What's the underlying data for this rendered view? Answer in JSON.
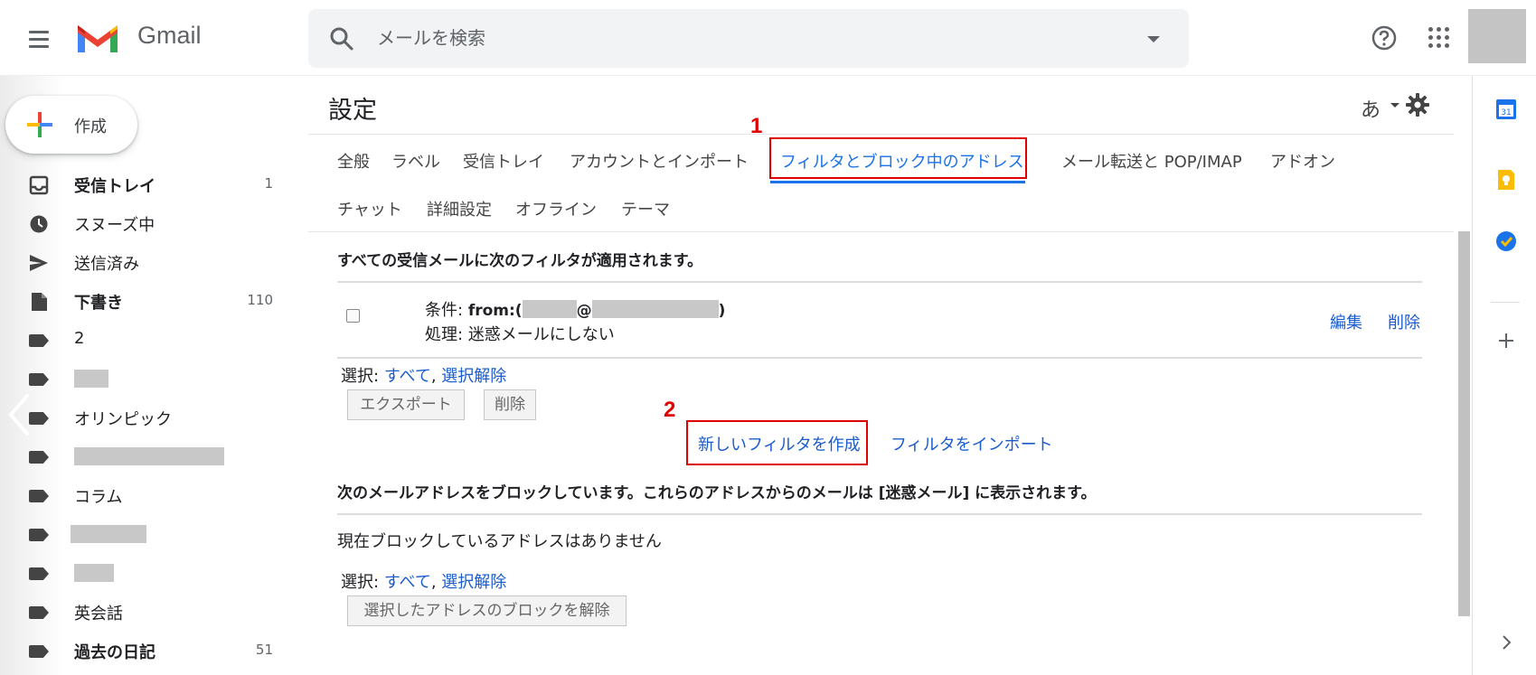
{
  "header": {
    "app_name": "Gmail",
    "search_placeholder": "メールを検索"
  },
  "sidebar": {
    "compose_label": "作成",
    "items": [
      {
        "label": "受信トレイ",
        "count": "1",
        "bold": true,
        "icon": "inbox-icon"
      },
      {
        "label": "スヌーズ中",
        "count": "",
        "bold": false,
        "icon": "clock-icon"
      },
      {
        "label": "送信済み",
        "count": "",
        "bold": false,
        "icon": "send-icon"
      },
      {
        "label": "下書き",
        "count": "110",
        "bold": true,
        "icon": "draft-icon"
      },
      {
        "label": "2",
        "count": "",
        "bold": false,
        "icon": "label-icon"
      },
      {
        "label": "",
        "count": "",
        "bold": false,
        "icon": "label-icon"
      },
      {
        "label": "オリンピック",
        "count": "",
        "bold": false,
        "icon": "label-icon"
      },
      {
        "label": "",
        "count": "",
        "bold": false,
        "icon": "label-icon"
      },
      {
        "label": "コラム",
        "count": "",
        "bold": false,
        "icon": "label-icon"
      },
      {
        "label": "",
        "count": "",
        "bold": false,
        "icon": "label-icon"
      },
      {
        "label": "",
        "count": "",
        "bold": false,
        "icon": "label-icon"
      },
      {
        "label": "英会話",
        "count": "",
        "bold": false,
        "icon": "label-icon"
      },
      {
        "label": "過去の日記",
        "count": "51",
        "bold": true,
        "icon": "label-icon"
      }
    ]
  },
  "settings": {
    "title": "設定",
    "lang_icon": "あ",
    "tabs": [
      "全般",
      "ラベル",
      "受信トレイ",
      "アカウントとインポート",
      "フィルタとブロック中のアドレス",
      "メール転送と POP/IMAP",
      "アドオン",
      "チャット",
      "詳細設定",
      "オフライン",
      "テーマ"
    ],
    "active_tab": "フィルタとブロック中のアドレス",
    "annotations": {
      "step1": "1",
      "step2": "2"
    },
    "filters": {
      "heading": "すべての受信メールに次のフィルタが適用されます。",
      "item": {
        "condition_label": "条件:",
        "condition_from": "from:(",
        "condition_at": "@",
        "condition_close": ")",
        "action_label": "処理:",
        "action_value": "迷惑メールにしない",
        "edit": "編集",
        "delete": "削除"
      },
      "select_label": "選択:",
      "select_all": "すべて",
      "select_none": "選択解除",
      "export_button": "エクスポート",
      "delete_button": "削除",
      "create_link": "新しいフィルタを作成",
      "import_link": "フィルタをインポート"
    },
    "blocked": {
      "heading": "次のメールアドレスをブロックしています。これらのアドレスからのメールは [迷惑メール] に表示されます。",
      "empty_text": "現在ブロックしているアドレスはありません",
      "select_label": "選択:",
      "select_all": "すべて",
      "select_none": "選択解除",
      "unblock_button": "選択したアドレスのブロックを解除"
    }
  },
  "side_panel": {
    "calendar_day": "31"
  },
  "colors": {
    "accent": "#1a73e8",
    "link": "#1a5ccd",
    "annotation": "#e00000"
  }
}
